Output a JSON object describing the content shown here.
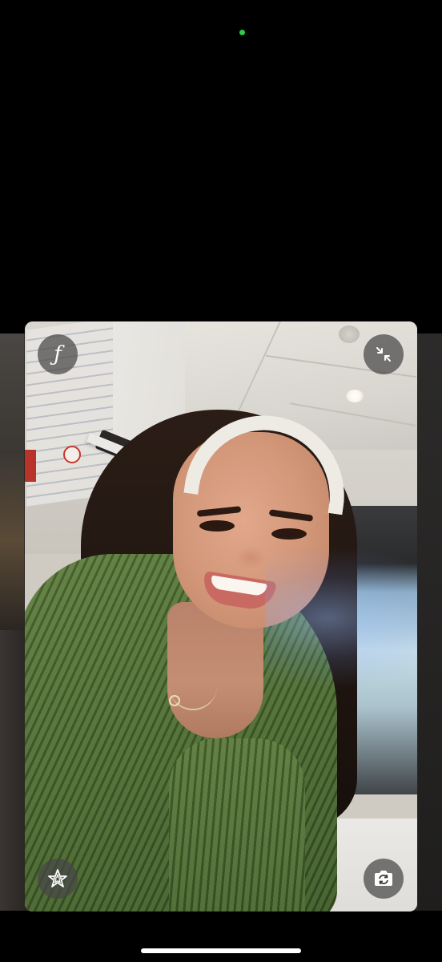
{
  "status": {
    "camera_indicator_color": "#2ecc4a"
  },
  "self_view": {
    "effects_button": {
      "icon": "function-f-icon",
      "glyph": "ƒ"
    },
    "collapse_button": {
      "icon": "collapse-arrows-icon"
    },
    "star_button": {
      "icon": "star-effects-icon"
    },
    "flip_camera_button": {
      "icon": "camera-flip-icon"
    }
  },
  "colors": {
    "background": "#000000",
    "button_bg": "rgba(70,70,70,0.72)",
    "icon": "#ffffff",
    "home_indicator": "#ffffff"
  }
}
